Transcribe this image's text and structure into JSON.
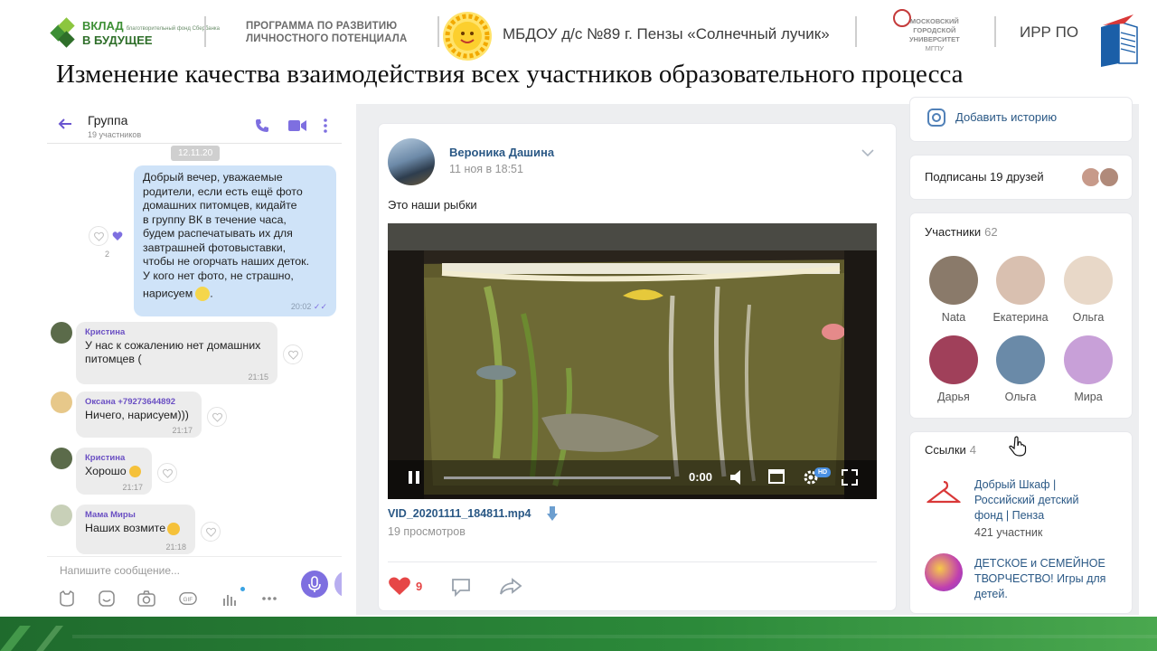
{
  "header": {
    "logo_vklad_line1": "ВКЛАД",
    "logo_vklad_line2": "В БУДУЩЕЕ",
    "logo_vklad_small": "благотворительный фонд Сбербанка",
    "program_line1": "ПРОГРАММА ПО РАЗВИТИЮ",
    "program_line2": "ЛИЧНОСТНОГО ПОТЕНЦИАЛА",
    "institution": "МБДОУ д/с №89 г. Пензы «Солнечный лучик»",
    "university_line1": "МОСКОВСКИЙ",
    "university_line2": "ГОРОДСКОЙ",
    "university_line3": "УНИВЕРСИТЕТ",
    "university_line4": "МГПУ",
    "irr": "ИРР ПО",
    "brand_green": "#2c8a3a"
  },
  "title": "Изменение качества взаимодействия всех участников образовательного процесса",
  "chat": {
    "name": "Группа",
    "members": "19 участников",
    "date": "12.11.20",
    "accent": "#7e6fe0",
    "outgoing": {
      "lines": [
        "Добрый вечер, уважаемые",
        "родители, если есть ещё фото",
        "домашних питомцев, кидайте",
        "в группу ВК в течение часа,",
        "будем распечатывать их для",
        "завтрашней фотовыставки,",
        "чтобы не огорчать наших деток.",
        "У кого нет фото, не страшно,",
        "нарисуем"
      ],
      "end_mark": ".",
      "time": "20:02",
      "reactions_count": "2"
    },
    "messages": [
      {
        "author": "Кристина",
        "lines": [
          "У нас к сожалению нет домашних",
          "питомцев ("
        ],
        "time": "21:15"
      },
      {
        "author": "Оксана +79273644892",
        "lines": [
          "Ничего, нарисуем)))"
        ],
        "time": "21:17"
      },
      {
        "author": "Кристина",
        "lines": [
          "Хорошо"
        ],
        "time": "21:17"
      },
      {
        "author": "Мама Миры",
        "lines": [
          "Наших возмите"
        ],
        "time": "21:18"
      }
    ],
    "composer_placeholder": "Напишите сообщение..."
  },
  "post": {
    "author": "Вероника Дашина",
    "date": "11 ноя в 18:51",
    "text": "Это наши рыбки",
    "video_time": "0:00",
    "video_progress": 0.0,
    "hd_badge": "HD",
    "file_name": "VID_20201111_184811.mp4",
    "views": "19 просмотров",
    "likes": "9",
    "link_color": "#2a5885",
    "like_color": "#e64646"
  },
  "sidebar": {
    "add_story": "Добавить историю",
    "friends_subscribed": "Подписаны 19 друзей",
    "members_label": "Участники",
    "members_count": "62",
    "members": [
      {
        "name": "Nata",
        "color": "#8a7a6a"
      },
      {
        "name": "Екатерина",
        "color": "#d9c0b0"
      },
      {
        "name": "Ольга",
        "color": "#e8d8c8"
      },
      {
        "name": "Дарья",
        "color": "#a0405a"
      },
      {
        "name": "Ольга",
        "color": "#6a8aa8"
      },
      {
        "name": "Мира",
        "color": "#c8a0d8"
      }
    ],
    "links_label": "Ссылки",
    "links_count": "4",
    "links": [
      {
        "title_lines": [
          "Добрый Шкаф |",
          "Российский детский",
          "фонд | Пенза"
        ],
        "sub": "421 участник"
      },
      {
        "title_lines": [
          "ДЕТСКОЕ и СЕМЕЙНОЕ",
          "ТВОРЧЕСТВО! Игры для",
          "детей."
        ],
        "sub": ""
      }
    ]
  }
}
